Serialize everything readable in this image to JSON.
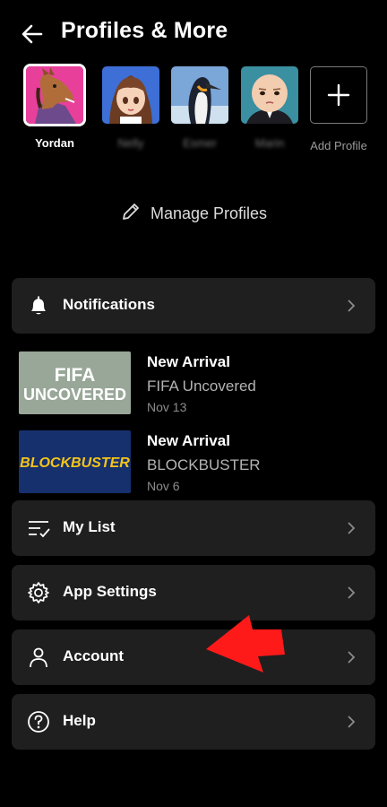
{
  "header": {
    "title": "Profiles & More",
    "back_icon": "back-arrow-icon"
  },
  "profiles": [
    {
      "name": "Yordan",
      "selected": true,
      "blurred": false
    },
    {
      "name": "Nelly",
      "selected": false,
      "blurred": true
    },
    {
      "name": "Esmer",
      "selected": false,
      "blurred": true
    },
    {
      "name": "Marin",
      "selected": false,
      "blurred": true
    }
  ],
  "add_profile": {
    "label": "Add Profile"
  },
  "manage_profiles": {
    "label": "Manage Profiles",
    "icon": "pencil-icon"
  },
  "notifications": {
    "label": "Notifications",
    "icon": "bell-icon",
    "items": [
      {
        "title": "New Arrival",
        "show": "FIFA Uncovered",
        "date": "Nov 13",
        "thumb_text_1": "FIFA",
        "thumb_text_2": "UNCOVERED"
      },
      {
        "title": "New Arrival",
        "show": "BLOCKBUSTER",
        "date": "Nov 6",
        "thumb_text_1": "BLOCKBUSTER"
      }
    ]
  },
  "menu": [
    {
      "label": "My List",
      "icon": "list-check-icon"
    },
    {
      "label": "App Settings",
      "icon": "gear-icon"
    },
    {
      "label": "Account",
      "icon": "person-icon"
    },
    {
      "label": "Help",
      "icon": "question-circle-icon"
    }
  ],
  "colors": {
    "background": "#000000",
    "row_bg": "#1f1f1f",
    "annotation_arrow": "#ff1a1a",
    "blockbuster_blue": "#16306e",
    "blockbuster_yellow": "#f5c518"
  }
}
